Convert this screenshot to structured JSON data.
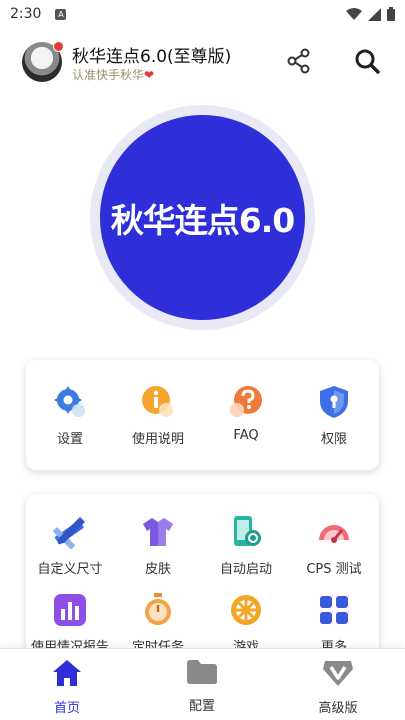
{
  "status_bar": {
    "time": "2:30",
    "notif_letter": "A"
  },
  "header": {
    "title": "秋华连点6.0(至尊版)",
    "subtitle": "认准快手秋华",
    "heart": "❤"
  },
  "hero": {
    "text": "秋华连点6.0",
    "color": "#2f2fd9"
  },
  "quick_menu": {
    "items": [
      {
        "label": "设置",
        "icon": "gear-icon"
      },
      {
        "label": "使用说明",
        "icon": "info-icon"
      },
      {
        "label": "FAQ",
        "icon": "question-icon"
      },
      {
        "label": "权限",
        "icon": "shield-icon"
      }
    ]
  },
  "tools_menu": {
    "items": [
      {
        "label": "自定义尺寸",
        "icon": "ruler-pencil-icon"
      },
      {
        "label": "皮肤",
        "icon": "shirt-icon"
      },
      {
        "label": "自动启动",
        "icon": "phone-auto-icon"
      },
      {
        "label": "CPS 测试",
        "icon": "speedometer-icon"
      },
      {
        "label": "使用情况报告",
        "icon": "bar-chart-icon"
      },
      {
        "label": "定时任务",
        "icon": "stopwatch-icon"
      },
      {
        "label": "游戏",
        "icon": "wheel-icon"
      },
      {
        "label": "更多",
        "icon": "grid-icon"
      }
    ]
  },
  "bottom_nav": {
    "items": [
      {
        "label": "首页",
        "icon": "home-icon",
        "active": true
      },
      {
        "label": "配置",
        "icon": "folder-icon",
        "active": false
      },
      {
        "label": "高级版",
        "icon": "v-badge-icon",
        "active": false
      }
    ]
  },
  "colors": {
    "accent": "#2f2fd9",
    "subtitle": "#9a8f6a"
  }
}
